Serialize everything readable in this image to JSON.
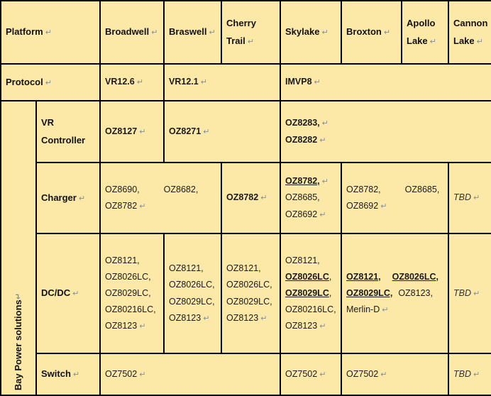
{
  "meta": {
    "colors": {
      "green": "#92D050",
      "cream": "#FCEBAE",
      "amber": "#FCB913",
      "border": "#000000"
    },
    "pilcrow": "↵"
  },
  "columns": {
    "row_label_1": "Platform",
    "platforms": [
      "Broadwell",
      "Braswell",
      "Cherry Trail",
      "Skylake",
      "Broxton",
      "Apollo Lake",
      "Cannon Lake"
    ]
  },
  "rows": {
    "protocol": {
      "label": "Protocol",
      "broadwell": "VR12.6",
      "braswell": "VR12.1",
      "skylake_span": "IMVP8"
    },
    "group_label": "Bay Power solutions",
    "vr_controller": {
      "label_line1": "VR",
      "label_line2": "Controller",
      "broadwell": "OZ8127",
      "braswell_cherrytrail": "OZ8271",
      "skylake_span_line1": "OZ8283,",
      "skylake_span_line2": "OZ8282"
    },
    "charger": {
      "label": "Charger",
      "broadwell_braswell_line1a": "OZ8690,",
      "broadwell_braswell_line1b": "OZ8682,",
      "broadwell_braswell_line2": "OZ8782",
      "cherrytrail": "OZ8782",
      "skylake_line1": "OZ8782,",
      "skylake_line2": "OZ8685,",
      "skylake_line3": "OZ8692",
      "broxton_apollo_line1a": "OZ8782,",
      "broxton_apollo_line1b": "OZ8685,",
      "broxton_apollo_line2": "OZ8692",
      "cannonlake": "TBD"
    },
    "dcdc": {
      "label": "DC/DC",
      "broadwell": [
        "OZ8121,",
        "OZ8026LC,",
        "OZ8029LC,",
        "OZ80216LC,",
        "OZ8123"
      ],
      "braswell": [
        "OZ8121,",
        "OZ8026LC,",
        "OZ8029LC,",
        "OZ8123"
      ],
      "cherrytrail": [
        "OZ8121,",
        "OZ8026LC,",
        "OZ8029LC,",
        "OZ8123"
      ],
      "skylake": [
        "OZ8121,",
        "OZ8026LC,",
        "OZ8029LC,",
        "OZ80216LC,",
        "OZ8123"
      ],
      "skylake_emphasis": [
        "OZ8026LC",
        "OZ8029LC"
      ],
      "broxton_apollo_line1a": "OZ8121,",
      "broxton_apollo_line1b": "OZ8026LC,",
      "broxton_apollo_line2a": "OZ8029LC,",
      "broxton_apollo_line2b": "OZ8123,",
      "broxton_apollo_line3": "Merlin-D",
      "cannonlake": "TBD"
    },
    "switch": {
      "label": "Switch",
      "broadwell_span": "OZ7502",
      "skylake": "OZ7502",
      "broxton_apollo": "OZ7502",
      "cannonlake": "TBD"
    }
  }
}
